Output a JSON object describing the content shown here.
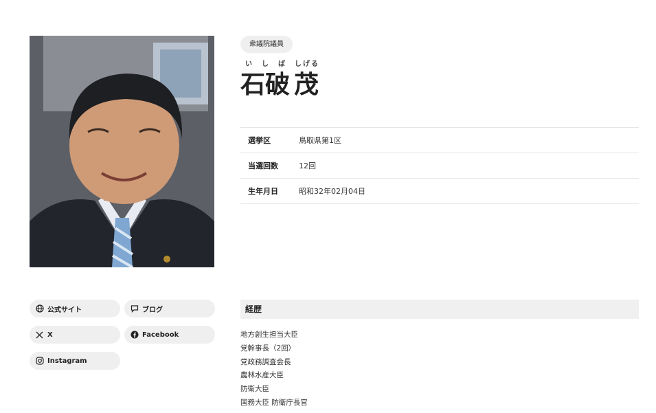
{
  "profile": {
    "badge": "衆議院議員",
    "name": {
      "surname": "石破",
      "surname_ruby": "いしば",
      "given": "茂",
      "given_ruby": "しげる"
    },
    "photo_icon": "portrait-photo"
  },
  "info": [
    {
      "label": "選挙区",
      "value": "鳥取県第1区"
    },
    {
      "label": "当選回数",
      "value": "12回"
    },
    {
      "label": "生年月日",
      "value": "昭和32年02月04日"
    }
  ],
  "links": [
    {
      "label": "公式サイト",
      "icon": "globe-icon"
    },
    {
      "label": "ブログ",
      "icon": "chat-bubble-icon"
    },
    {
      "label": "X",
      "icon": "x-logo-icon"
    },
    {
      "label": "Facebook",
      "icon": "facebook-icon"
    },
    {
      "label": "Instagram",
      "icon": "instagram-icon"
    }
  ],
  "career": {
    "heading": "経歴",
    "items": [
      "地方創生担当大臣",
      "党幹事長（2回）",
      "党政務調査会長",
      "農林水産大臣",
      "防衛大臣",
      "国務大臣 防衛庁長官"
    ]
  },
  "colors": {
    "pill_bg": "#efefef",
    "border": "#e5e5e5",
    "text": "#222222"
  }
}
